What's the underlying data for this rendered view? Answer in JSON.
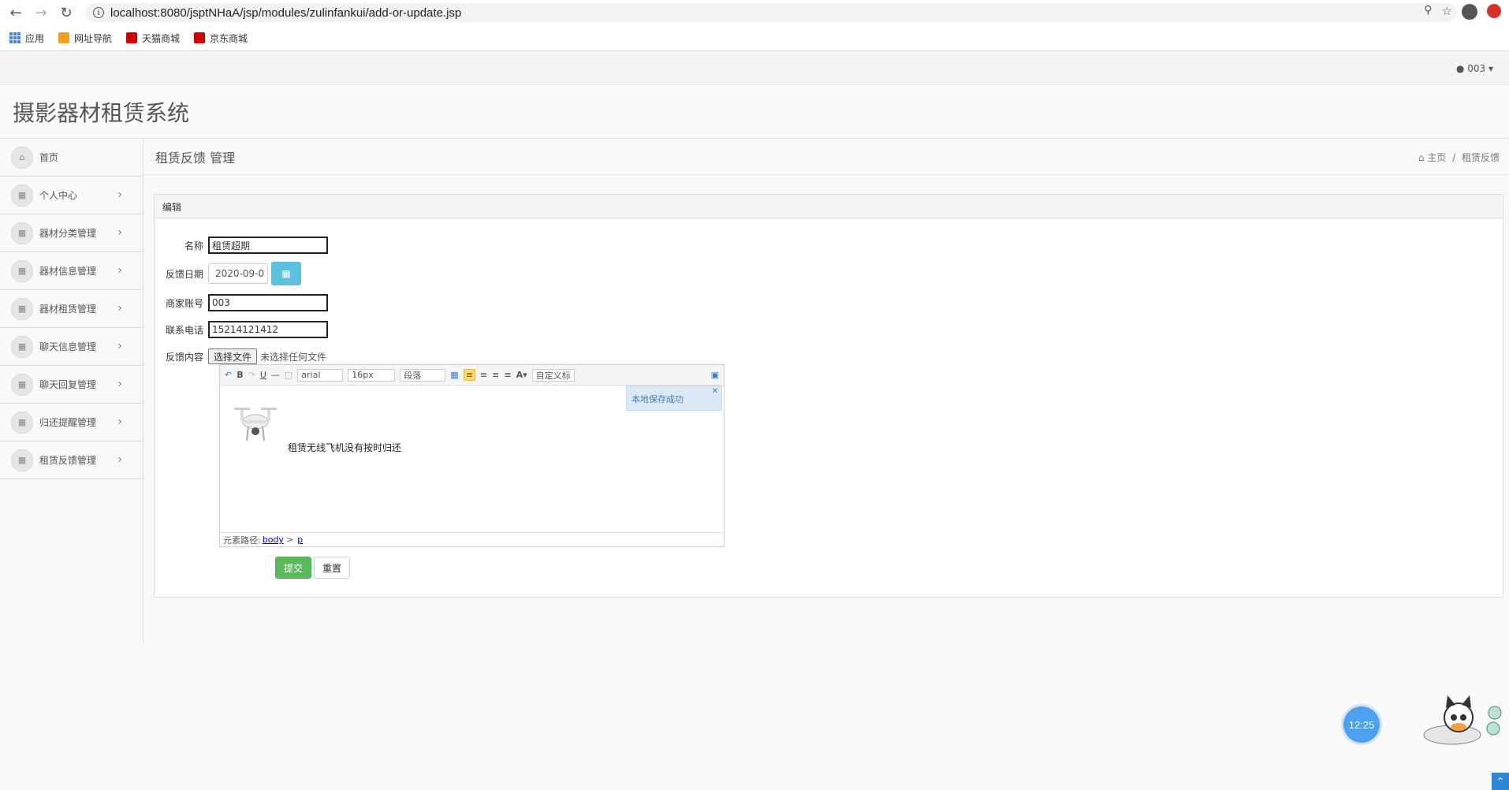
{
  "browser": {
    "url": "localhost:8080/jsptNHaA/jsp/modules/zulinfankui/add-or-update.jsp",
    "bookmarks": [
      {
        "label": "应用"
      },
      {
        "label": "网址导航"
      },
      {
        "label": "天猫商城"
      },
      {
        "label": "京东商城"
      }
    ]
  },
  "header": {
    "user": "003",
    "brand": "摄影器材租赁系统"
  },
  "sidebar": {
    "items": [
      {
        "label": "首页"
      },
      {
        "label": "个人中心"
      },
      {
        "label": "器材分类管理"
      },
      {
        "label": "器材信息管理"
      },
      {
        "label": "器材租赁管理"
      },
      {
        "label": "聊天信息管理"
      },
      {
        "label": "聊天回复管理"
      },
      {
        "label": "归还提醒管理"
      },
      {
        "label": "租赁反馈管理"
      }
    ]
  },
  "page": {
    "title": "租赁反馈 管理",
    "breadcrumb_home": "主页",
    "breadcrumb_sep": "/",
    "breadcrumb_current": "租赁反馈"
  },
  "form": {
    "panel_title": "编辑",
    "name_label": "名称",
    "name_value": "租赁超期",
    "date_label": "反馈日期",
    "date_value": "2020-09-0",
    "account_label": "商家账号",
    "account_value": "003",
    "phone_label": "联系电话",
    "phone_value": "15214121412",
    "content_label": "反馈内容",
    "file_button": "选择文件",
    "file_status": "未选择任何文件",
    "submit": "提交",
    "reset": "重置"
  },
  "editor": {
    "font": "arial",
    "size": "16px",
    "paragraph": "段落",
    "custom_title": "自定义标",
    "saved_tip": "本地保存成功",
    "content_text": "租赁无线飞机没有按时归还",
    "path_label": "元素路径:",
    "path_body": "body",
    "path_sep": ">",
    "path_p": "p"
  },
  "clock": "12:25",
  "colors": {
    "submit": "#5cb85c",
    "calendar": "#5bc0de",
    "clock": "#4d9ff0"
  }
}
